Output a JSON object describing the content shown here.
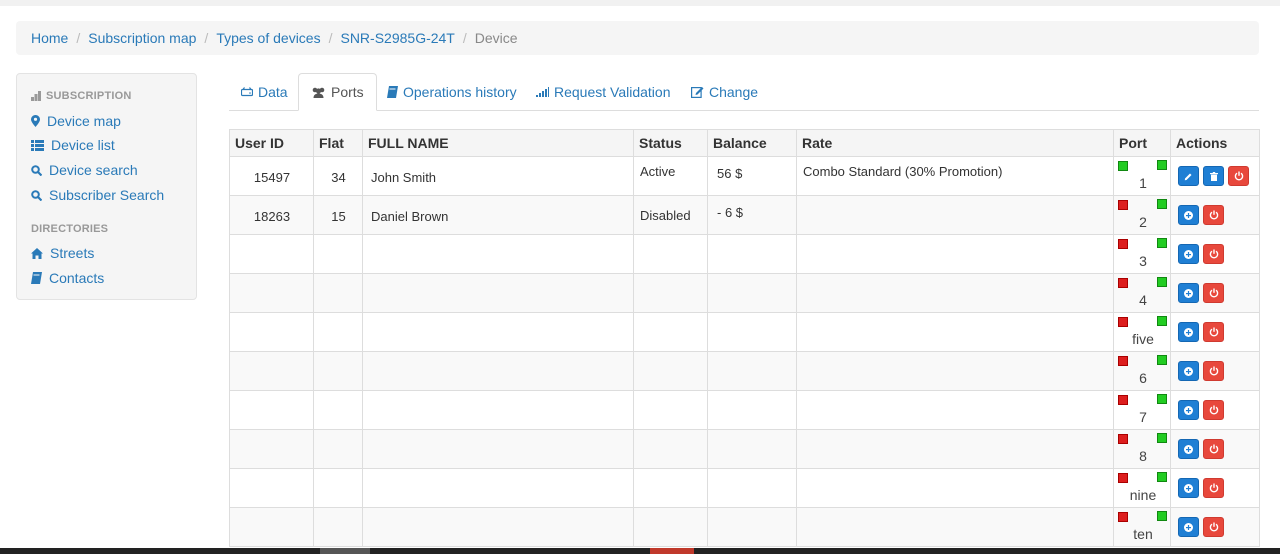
{
  "breadcrumb": {
    "items": [
      "Home",
      "Subscription map",
      "Types of devices",
      "SNR-S2985G-24T"
    ],
    "active": "Device"
  },
  "sidebar": {
    "subscription_header": "SUBSCRIPTION",
    "directories_header": "DIRECTORIES",
    "items": {
      "device_map": "Device map",
      "device_list": "Device list",
      "device_search": "Device search",
      "subscriber_search": "Subscriber Search",
      "streets": "Streets",
      "contacts": "Contacts"
    }
  },
  "tabs": {
    "data": "Data",
    "ports": "Ports",
    "operations_history": "Operations history",
    "request_validation": "Request Validation",
    "change": "Change",
    "active": "ports"
  },
  "table": {
    "headers": [
      "User ID",
      "Flat",
      "FULL NAME",
      "Status",
      "Balance",
      "Rate",
      "Port",
      "Actions"
    ],
    "rows": [
      {
        "user_id": "15497",
        "flat": "34",
        "full_name": "John Smith",
        "status": "Active",
        "balance": "56 $",
        "rate": "Combo Standard (30% Promotion)",
        "port": "1",
        "left_led": "green",
        "right_led": "green",
        "actions": [
          "edit",
          "delete",
          "power"
        ]
      },
      {
        "user_id": "18263",
        "flat": "15",
        "full_name": "Daniel Brown",
        "status": "Disabled",
        "balance": "- 6 $",
        "rate": "",
        "port": "2",
        "left_led": "red",
        "right_led": "green",
        "actions": [
          "add",
          "power"
        ]
      },
      {
        "user_id": "",
        "flat": "",
        "full_name": "",
        "status": "",
        "balance": "",
        "rate": "",
        "port": "3",
        "left_led": "red",
        "right_led": "green",
        "actions": [
          "add",
          "power"
        ]
      },
      {
        "user_id": "",
        "flat": "",
        "full_name": "",
        "status": "",
        "balance": "",
        "rate": "",
        "port": "4",
        "left_led": "red",
        "right_led": "green",
        "actions": [
          "add",
          "power"
        ]
      },
      {
        "user_id": "",
        "flat": "",
        "full_name": "",
        "status": "",
        "balance": "",
        "rate": "",
        "port": "five",
        "left_led": "red",
        "right_led": "green",
        "actions": [
          "add",
          "power"
        ]
      },
      {
        "user_id": "",
        "flat": "",
        "full_name": "",
        "status": "",
        "balance": "",
        "rate": "",
        "port": "6",
        "left_led": "red",
        "right_led": "green",
        "actions": [
          "add",
          "power"
        ]
      },
      {
        "user_id": "",
        "flat": "",
        "full_name": "",
        "status": "",
        "balance": "",
        "rate": "",
        "port": "7",
        "left_led": "red",
        "right_led": "green",
        "actions": [
          "add",
          "power"
        ]
      },
      {
        "user_id": "",
        "flat": "",
        "full_name": "",
        "status": "",
        "balance": "",
        "rate": "",
        "port": "8",
        "left_led": "red",
        "right_led": "green",
        "actions": [
          "add",
          "power"
        ]
      },
      {
        "user_id": "",
        "flat": "",
        "full_name": "",
        "status": "",
        "balance": "",
        "rate": "",
        "port": "nine",
        "left_led": "red",
        "right_led": "green",
        "actions": [
          "add",
          "power"
        ]
      },
      {
        "user_id": "",
        "flat": "",
        "full_name": "",
        "status": "",
        "balance": "",
        "rate": "",
        "port": "ten",
        "left_led": "red",
        "right_led": "green",
        "actions": [
          "add",
          "power"
        ]
      }
    ]
  },
  "colors": {
    "link": "#2a7ab8",
    "led_red": "#dd1e1e",
    "led_green": "#22cc22",
    "btn_blue": "#1f7fd4",
    "btn_red": "#e8483c"
  }
}
